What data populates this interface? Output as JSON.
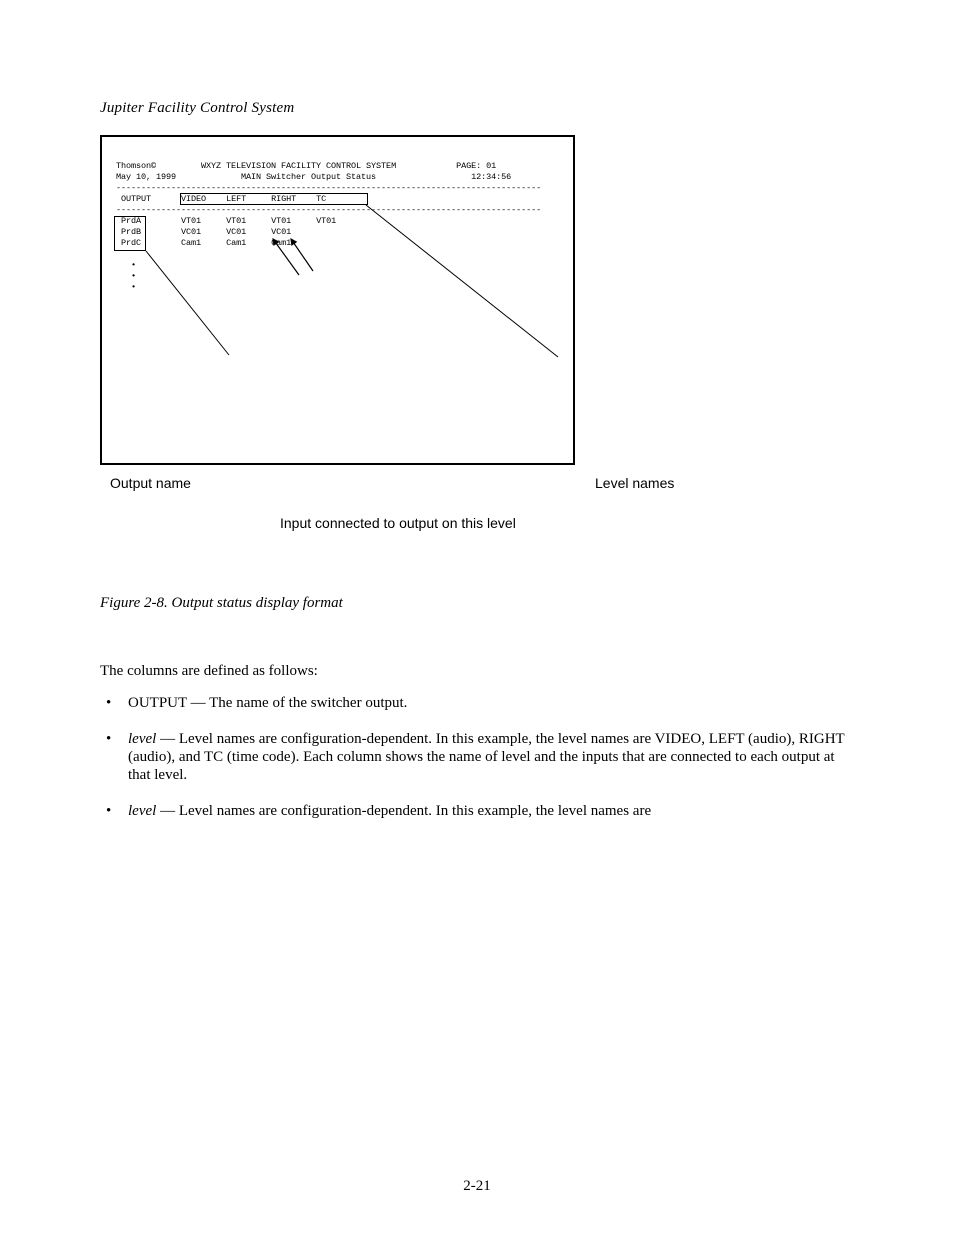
{
  "section_label": "Jupiter Facility Control System",
  "terminal": {
    "brand": "Thomson©",
    "date": "May 10, 1999",
    "system_title": "WXYZ TELEVISION FACILITY CONTROL SYSTEM",
    "subtitle": "MAIN Switcher Output Status",
    "page_label": "PAGE: 01",
    "time": "12:34:56",
    "columns": {
      "output": "OUTPUT",
      "video": "VIDEO",
      "left": "LEFT",
      "right": "RIGHT",
      "tc": "TC"
    },
    "rows": [
      {
        "output": "PrdA",
        "video": "VT01",
        "left": "VT01",
        "right": "VT01",
        "tc": "VT01"
      },
      {
        "output": "PrdB",
        "video": "VC01",
        "left": "VC01",
        "right": "VC01",
        "tc": ""
      },
      {
        "output": "PrdC",
        "video": "Cam1",
        "left": "Cam1",
        "right": "Cam1",
        "tc": ""
      }
    ],
    "ellipsis": [
      "•",
      "•",
      "•"
    ]
  },
  "callouts": {
    "output_name": "Output name",
    "level_names": "Level names",
    "input_connected": "Input connected to output on this level"
  },
  "figure_caption": "Figure 2-8. Output status display format",
  "body": {
    "intro": "The columns are defined as follows:",
    "items": [
      {
        "label": "OUTPUT",
        "text": " — The name of the switcher output."
      },
      {
        "label": "level",
        "text": " — Level names are configuration-dependent. In this example, the level names are VIDEO, LEFT (audio), RIGHT (audio), and TC (time code). Each column shows the name of level and the inputs that are connected to each output at that level."
      }
    ],
    "outro_label": "level",
    "outro_text": " — Level names are configuration-dependent. In this example, the level names are"
  },
  "page_number": "2-21"
}
